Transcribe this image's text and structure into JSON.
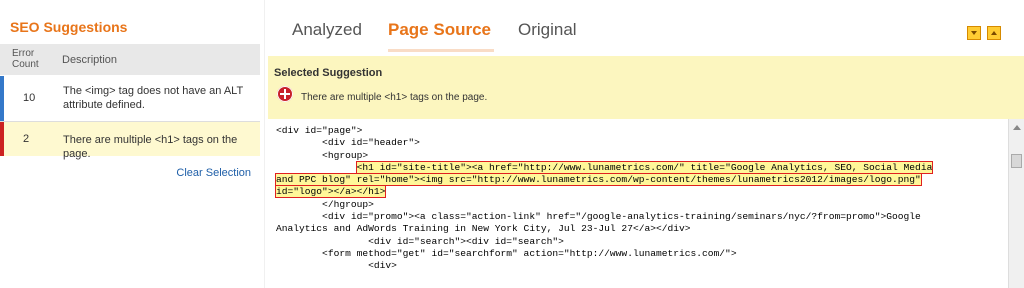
{
  "left_panel": {
    "title": "SEO Suggestions",
    "columns": {
      "count_line1": "Error",
      "count_line2": "Count",
      "description": "Description"
    },
    "rows": [
      {
        "count": "10",
        "description": "The <img> tag does not have an ALT attribute defined.",
        "status_color": "#3478c9"
      },
      {
        "count": "2",
        "description": "There are multiple <h1> tags on the page.",
        "status_color": "#cc2222"
      }
    ],
    "clear_selection": "Clear Selection"
  },
  "tabs": [
    {
      "label": "Analyzed",
      "active": false
    },
    {
      "label": "Page Source",
      "active": true
    },
    {
      "label": "Original",
      "active": false
    }
  ],
  "toolbar_icons": [
    "expand-icon",
    "collapse-icon"
  ],
  "selected_suggestion": {
    "title": "Selected Suggestion",
    "text": "There are multiple <h1> tags on the page."
  },
  "code_lines": {
    "l1": "<div id=\"page\">",
    "l2": "        <div id=\"header\">",
    "l3": "        <hgroup>",
    "l4_indent": "              ",
    "l4": "<h1 id=\"site-title\"><a href=\"http://www.lunametrics.com/\" title=\"Google Analytics, SEO, Social Media",
    "l5": "and PPC blog\" rel=\"home\"><img src=\"http://www.lunametrics.com/wp-content/themes/lunametrics2012/images/logo.png\"",
    "l6": "id=\"logo\"></a></h1>",
    "l7": "        </hgroup>",
    "l8": "        <div id=\"promo\"><a class=\"action-link\" href=\"/google-analytics-training/seminars/nyc/?from=promo\">Google",
    "l9": "Analytics and AdWords Training in New York City, Jul 23-Jul 27</a></div>",
    "l10": "                <div id=\"search\"><div id=\"search\">",
    "l11": "        <form method=\"get\" id=\"searchform\" action=\"http://www.lunametrics.com/\">",
    "l12": "                <div>"
  },
  "colors": {
    "accent": "#e8751a",
    "highlight": "#fff799",
    "highlight_border": "#e02020",
    "selected_bg": "#fcf6bf"
  }
}
